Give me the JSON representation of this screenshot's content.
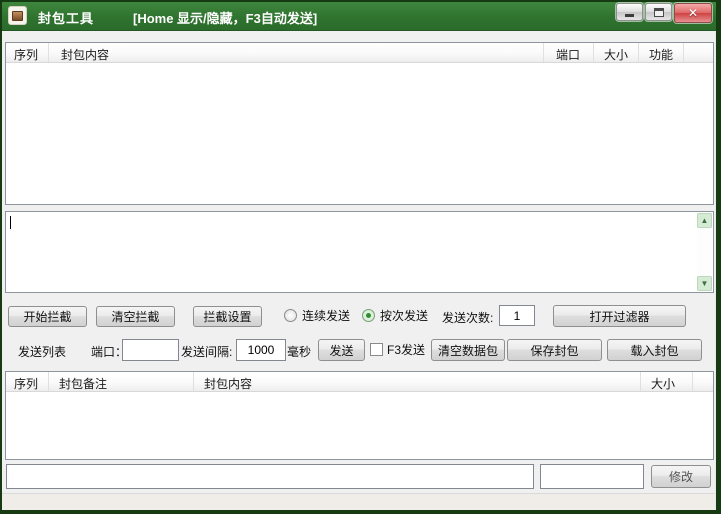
{
  "window": {
    "title": "封包工具",
    "subtitle": "[Home 显示/隐藏，F3自动发送]"
  },
  "icons": {
    "close": "✕",
    "scroll_up": "▲",
    "scroll_down": "▼"
  },
  "colors": {
    "titlebar_green": "#327a32",
    "frame_green": "#163a12",
    "close_button_red": "#ce4343",
    "radio_selected_green": "#2f8f2f",
    "scrollbar_button_green": "#d6ebd6"
  },
  "capture_table": {
    "columns": [
      "序列",
      "封包内容",
      "端口",
      "大小",
      "功能"
    ],
    "rows": []
  },
  "edit_area": {
    "value": ""
  },
  "row1": {
    "start_button": "开始拦截",
    "clear_button": "清空拦截",
    "settings_button": "拦截设置",
    "radio_continuous": "连续发送",
    "radio_by_count": "按次发送",
    "selected_radio": "by_count",
    "send_count_label": "发送次数:",
    "send_count_value": "1",
    "open_filter_button": "打开过滤器"
  },
  "row2": {
    "send_list_label": "发送列表",
    "port_label": "端口：",
    "port_value": "",
    "interval_label": "发送间隔:",
    "interval_value": "1000",
    "ms_label": "毫秒",
    "send_button": "发送",
    "f3_checkbox_label": "F3发送",
    "f3_checked": false,
    "clear_packets_button": "清空数据包",
    "save_packet_button": "保存封包",
    "load_packet_button": "载入封包"
  },
  "send_table": {
    "columns": [
      "序列",
      "封包备注",
      "封包内容",
      "大小"
    ],
    "rows": []
  },
  "bottom": {
    "content_value": "",
    "note_value": "",
    "modify_button": "修改"
  }
}
